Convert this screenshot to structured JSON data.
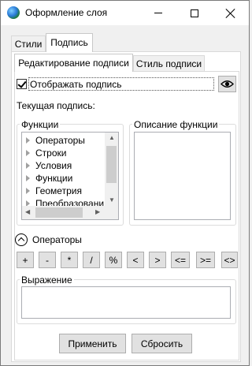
{
  "window": {
    "title": "Оформление слоя"
  },
  "tabs": {
    "main": [
      "Стили",
      "Подпись"
    ],
    "sub": [
      "Редактирование подписи",
      "Стиль подписи"
    ]
  },
  "label_panel": {
    "show_label": "Отображать подпись",
    "current_label": "Текущая подпись:",
    "functions_group": "Функции",
    "functions_list": [
      "Операторы",
      "Строки",
      "Условия",
      "Функции",
      "Геометрия",
      "Преобразовани"
    ],
    "description_group": "Описание функции",
    "operators_toggle": "Операторы",
    "operators": [
      "+",
      "-",
      "*",
      "/",
      "%",
      "<",
      ">",
      "<=",
      ">=",
      "<>"
    ],
    "expression_group": "Выражение",
    "expression_value": ""
  },
  "footer": {
    "apply": "Применить",
    "reset": "Сбросить"
  }
}
